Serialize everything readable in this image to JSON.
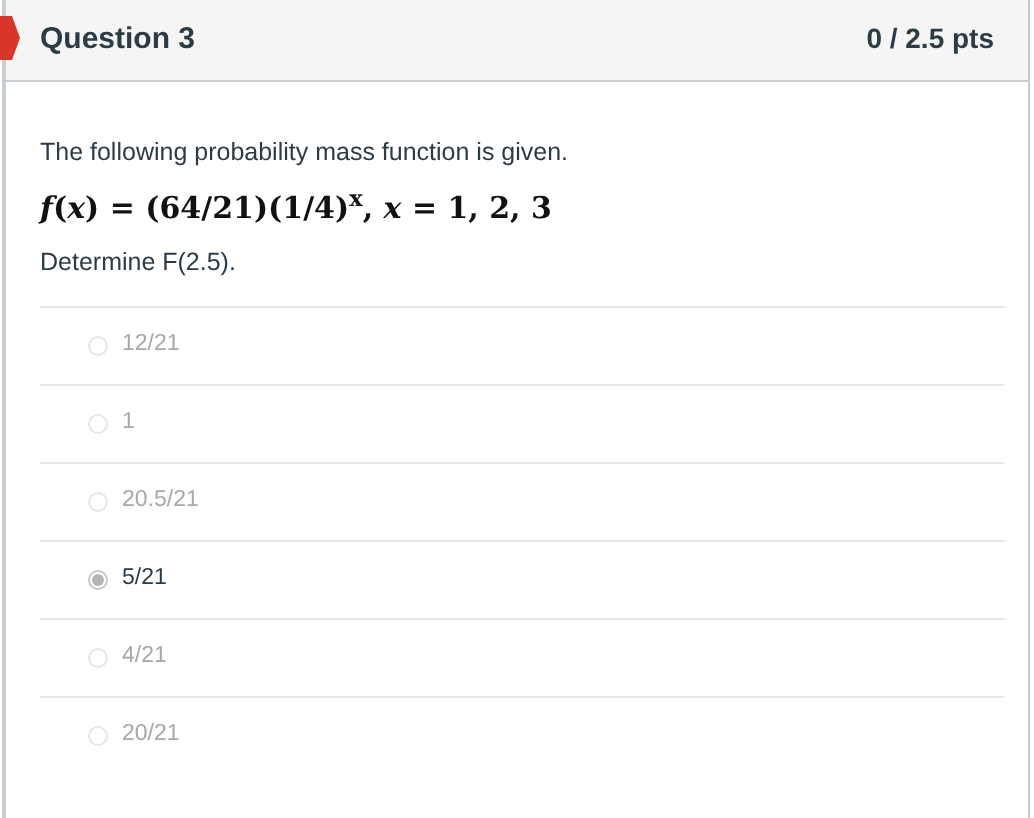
{
  "question": {
    "title": "Question 3",
    "points": "0 / 2.5 pts"
  },
  "prompt": "The following probability mass function is given.",
  "formula": "*f*(*x*) = (64/21)(1/4)$^{x}$, *x* = 1, 2, 3",
  "instruction": "Determine F(2.5).",
  "answers": [
    {
      "label": "12/21",
      "selected": false
    },
    {
      "label": "1",
      "selected": false
    },
    {
      "label": "20.5/21",
      "selected": false
    },
    {
      "label": "5/21",
      "selected": true
    },
    {
      "label": "4/21",
      "selected": false
    },
    {
      "label": "20/21",
      "selected": false
    }
  ]
}
